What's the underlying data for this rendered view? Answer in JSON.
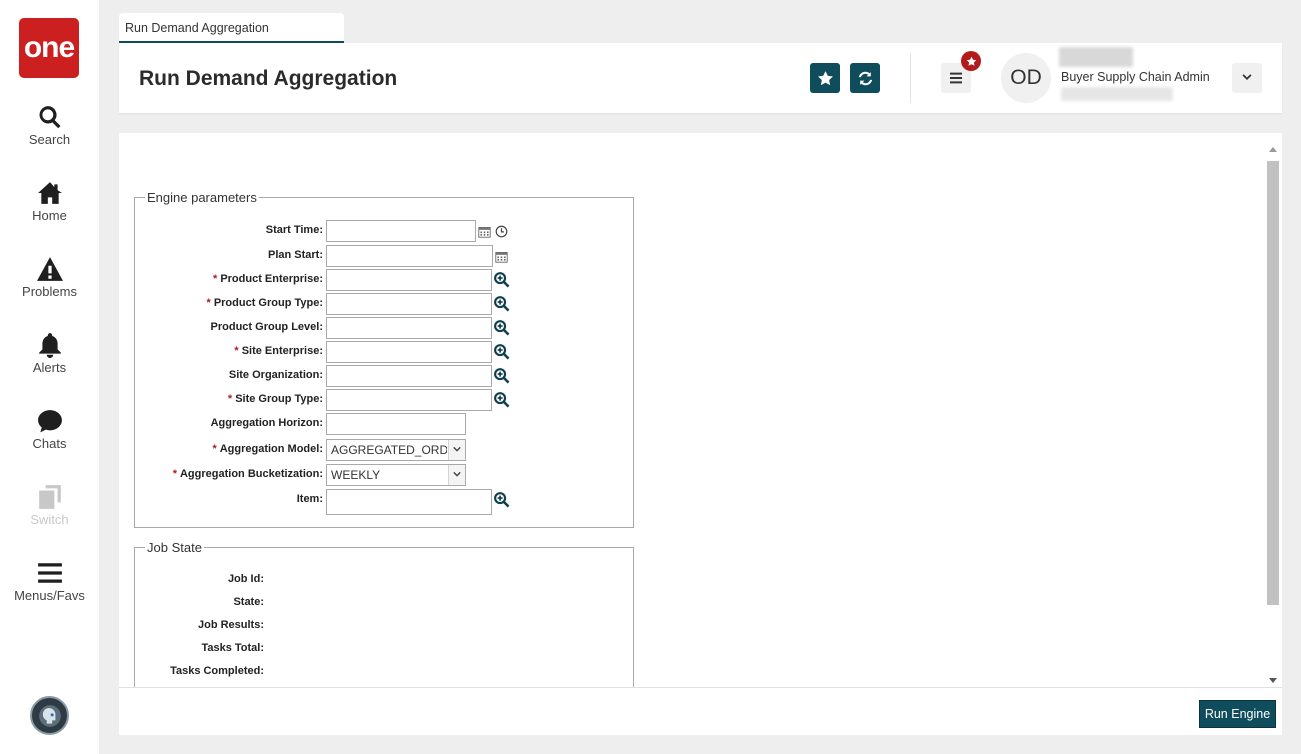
{
  "sidebar": {
    "logo_text": "one",
    "items": [
      {
        "label": "Search",
        "icon": "search-icon"
      },
      {
        "label": "Home",
        "icon": "home-icon"
      },
      {
        "label": "Problems",
        "icon": "warning-icon"
      },
      {
        "label": "Alerts",
        "icon": "bell-icon"
      },
      {
        "label": "Chats",
        "icon": "chat-bubble-icon"
      },
      {
        "label": "Switch",
        "icon": "switch-icon",
        "disabled": true
      },
      {
        "label": "Menus/Favs",
        "icon": "hamburger-icon"
      }
    ]
  },
  "tab": {
    "label": "Run Demand Aggregation"
  },
  "header": {
    "title": "Run Demand Aggregation",
    "favorite_icon": "star-icon",
    "refresh_icon": "refresh-icon",
    "menu_icon": "menu-icon",
    "user_initials": "OD",
    "user_role": "Buyer Supply Chain Admin"
  },
  "engine_parameters": {
    "legend": "Engine parameters",
    "fields": {
      "start_time": {
        "label": "Start Time:",
        "required": false,
        "value": ""
      },
      "plan_start": {
        "label": "Plan Start:",
        "required": false,
        "value": ""
      },
      "product_enterprise": {
        "label": "Product Enterprise:",
        "required": true,
        "value": ""
      },
      "product_group_type": {
        "label": "Product Group Type:",
        "required": true,
        "value": ""
      },
      "product_group_level": {
        "label": "Product Group Level:",
        "required": false,
        "value": ""
      },
      "site_enterprise": {
        "label": "Site Enterprise:",
        "required": true,
        "value": ""
      },
      "site_organization": {
        "label": "Site Organization:",
        "required": false,
        "value": ""
      },
      "site_group_type": {
        "label": "Site Group Type:",
        "required": true,
        "value": ""
      },
      "aggregation_horizon": {
        "label": "Aggregation Horizon:",
        "required": false,
        "value": ""
      },
      "aggregation_model": {
        "label": "Aggregation Model:",
        "required": true,
        "value": "AGGREGATED_ORDEI"
      },
      "aggregation_bucketization": {
        "label": "Aggregation Bucketization:",
        "required": true,
        "value": "WEEKLY"
      },
      "item": {
        "label": "Item:",
        "required": false,
        "value": ""
      }
    }
  },
  "job_state": {
    "legend": "Job State",
    "fields": {
      "job_id": {
        "label": "Job Id:"
      },
      "state": {
        "label": "State:"
      },
      "job_results": {
        "label": "Job Results:"
      },
      "tasks_total": {
        "label": "Tasks Total:"
      },
      "tasks_completed": {
        "label": "Tasks Completed:"
      }
    }
  },
  "footer": {
    "run_button": "Run Engine"
  },
  "colors": {
    "brand_red": "#cc1f1f",
    "accent_teal": "#0f4c5c",
    "required_red": "#b31b1b"
  }
}
